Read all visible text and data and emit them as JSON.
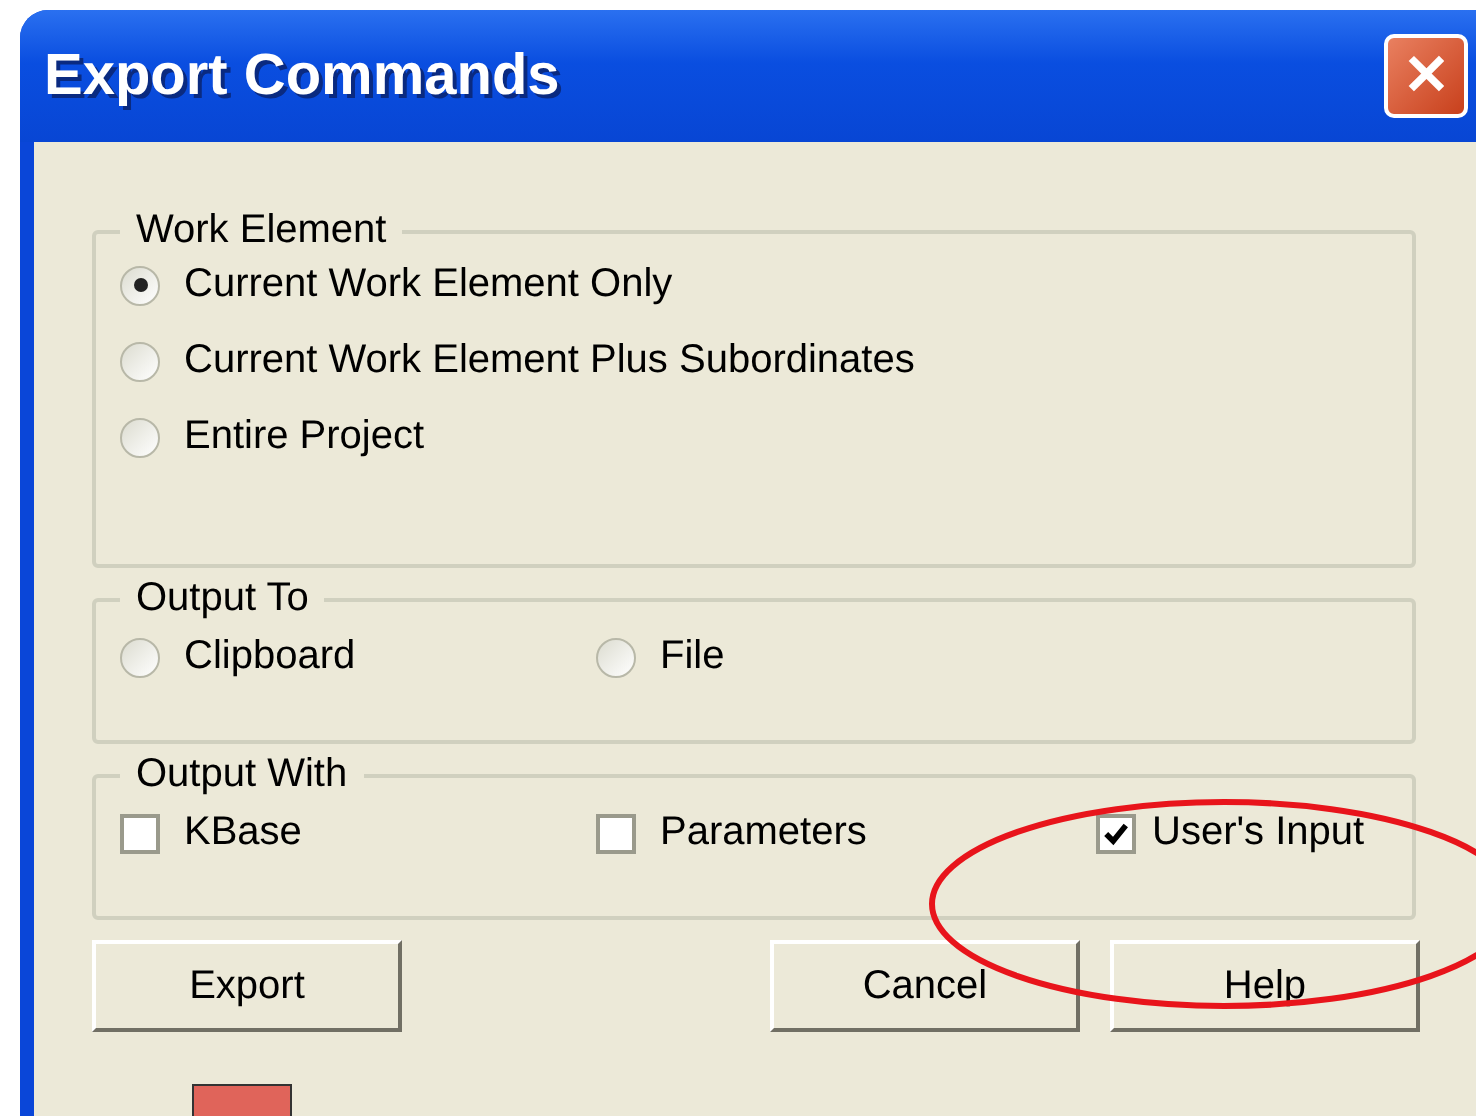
{
  "window": {
    "title": "Export Commands",
    "close": "✕"
  },
  "groups": [
    {
      "title": "Work Element",
      "options": [
        {
          "kind": "radio",
          "label": "Current Work Element Only",
          "selected": true
        },
        {
          "kind": "radio",
          "label": "Current Work Element Plus Subordinates",
          "selected": false
        },
        {
          "kind": "radio",
          "label": "Entire Project",
          "selected": false
        }
      ]
    },
    {
      "title": "Output To",
      "options": [
        {
          "kind": "radio",
          "label": "Clipboard",
          "selected": false
        },
        {
          "kind": "radio",
          "label": "File",
          "selected": false
        }
      ]
    },
    {
      "title": "Output With",
      "options": [
        {
          "kind": "checkbox",
          "label": "KBase",
          "checked": false
        },
        {
          "kind": "checkbox",
          "label": "Parameters",
          "checked": false
        },
        {
          "kind": "checkbox",
          "label": "User's Input",
          "checked": true
        }
      ]
    }
  ],
  "buttons": [
    "Export",
    "Cancel",
    "Help"
  ]
}
